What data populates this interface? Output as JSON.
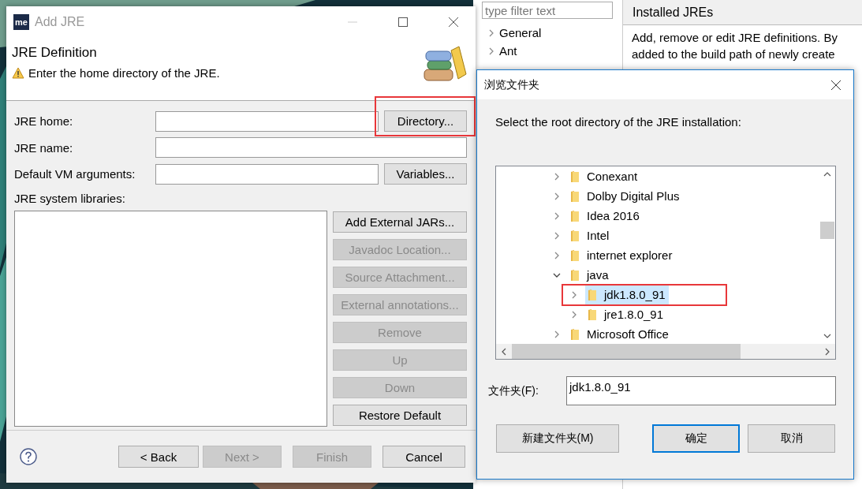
{
  "preferences_window": {
    "filter": {
      "placeholder": "type filter text"
    },
    "tree": [
      {
        "label": "General"
      },
      {
        "label": "Ant"
      }
    ],
    "page_title": "Installed JREs",
    "description_lines": [
      "Add, remove or edit JRE definitions. By",
      "added to the build path of newly create"
    ]
  },
  "add_jre_dialog": {
    "icon_label": "me",
    "title": "Add JRE",
    "header_title": "JRE Definition",
    "message": "Enter the home directory of the JRE.",
    "fields": [
      {
        "label": "JRE home:",
        "button": {
          "label": "Directory...",
          "highlighted": true
        }
      },
      {
        "label": "JRE name:"
      },
      {
        "label": "Default VM arguments:",
        "button": {
          "label": "Variables...",
          "highlighted": false
        }
      }
    ],
    "libraries_label": "JRE system libraries:",
    "library_buttons": [
      {
        "label": "Add External JARs...",
        "disabled": false
      },
      {
        "label": "Javadoc Location...",
        "disabled": true
      },
      {
        "label": "Source Attachment...",
        "disabled": true
      },
      {
        "label": "External annotations...",
        "disabled": true
      },
      {
        "label": "Remove",
        "disabled": true
      },
      {
        "label": "Up",
        "disabled": true
      },
      {
        "label": "Down",
        "disabled": true
      },
      {
        "label": "Restore Default",
        "disabled": false
      }
    ],
    "nav_buttons": [
      {
        "label": "< Back",
        "disabled": false
      },
      {
        "label": "Next >",
        "disabled": true
      },
      {
        "label": "Finish",
        "disabled": true
      },
      {
        "label": "Cancel",
        "disabled": false
      }
    ]
  },
  "browse_dialog": {
    "title": "浏览文件夹",
    "instruction": "Select the root directory of the JRE installation:",
    "tree": [
      {
        "label": "Conexant",
        "expanded": false,
        "selected": false,
        "highlighted": false
      },
      {
        "label": "Dolby Digital Plus",
        "expanded": false,
        "selected": false,
        "highlighted": false
      },
      {
        "label": "Idea 2016",
        "expanded": false,
        "selected": false,
        "highlighted": false
      },
      {
        "label": "Intel",
        "expanded": false,
        "selected": false,
        "highlighted": false
      },
      {
        "label": "internet explorer",
        "expanded": false,
        "selected": false,
        "highlighted": false
      },
      {
        "label": "java",
        "expanded": true,
        "selected": false,
        "highlighted": false,
        "children": [
          {
            "label": "jdk1.8.0_91",
            "expanded": false,
            "selected": true,
            "highlighted": true
          },
          {
            "label": "jre1.8.0_91",
            "expanded": false,
            "selected": false,
            "highlighted": false
          }
        ]
      },
      {
        "label": "Microsoft Office",
        "expanded": false,
        "selected": false,
        "highlighted": false
      }
    ],
    "folder_label": "文件夹(F):",
    "folder_value": "jdk1.8.0_91",
    "buttons": [
      {
        "label": "新建文件夹(M)",
        "default": false
      },
      {
        "label": "确定",
        "default": true
      },
      {
        "label": "取消",
        "default": false
      }
    ]
  }
}
